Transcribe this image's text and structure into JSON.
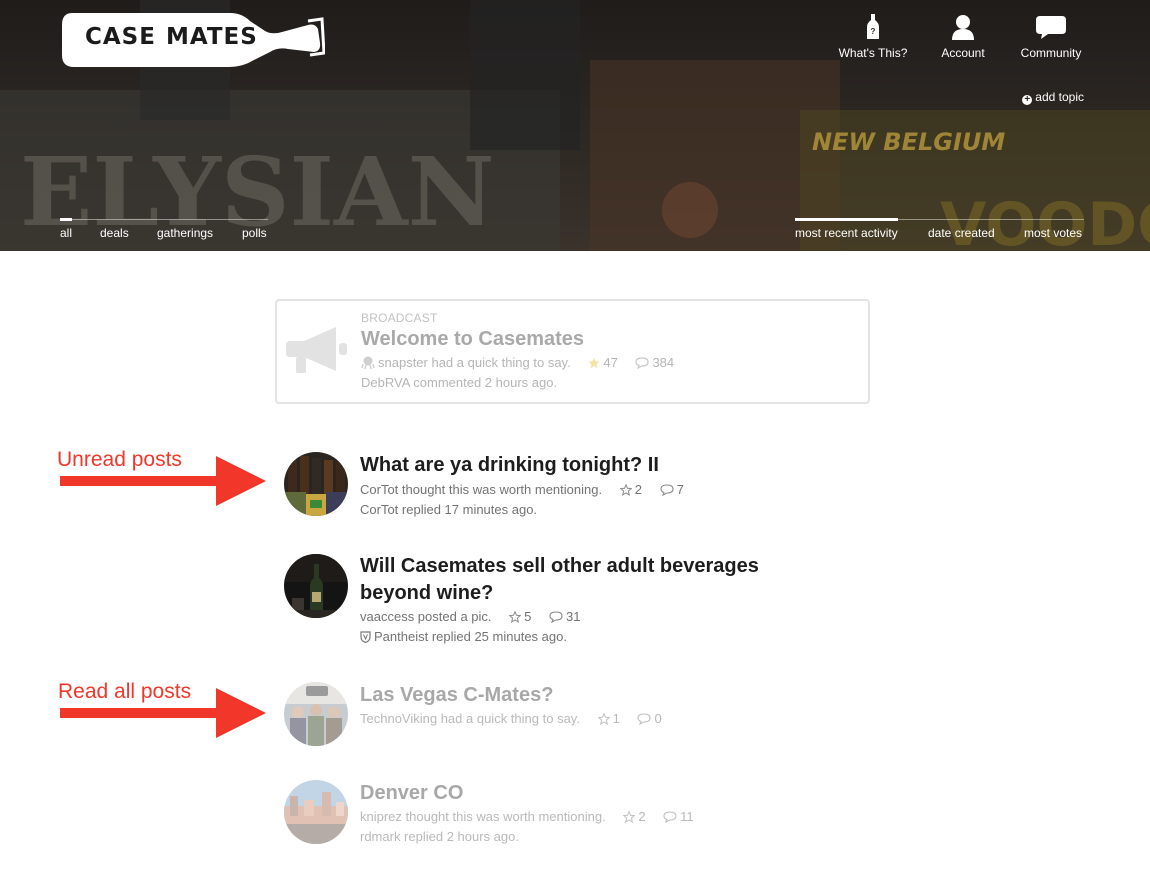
{
  "header": {
    "logo_left": "CASE",
    "logo_right": "MATES",
    "nav": [
      {
        "label": "What's This?",
        "icon": "bottle-icon"
      },
      {
        "label": "Account",
        "icon": "user-icon"
      },
      {
        "label": "Community",
        "icon": "speech-bubble-icon"
      }
    ],
    "add_topic": "add topic",
    "filters_left": [
      "all",
      "deals",
      "gatherings",
      "polls"
    ],
    "filters_left_active": "all",
    "filters_right": [
      "most recent activity",
      "date created",
      "most votes"
    ],
    "filters_right_active": "most recent activity"
  },
  "broadcast": {
    "label": "BROADCAST",
    "title": "Welcome to Casemates",
    "meta": "snapster had a quick thing to say.",
    "stars": "47",
    "comments": "384",
    "sub": "DebRVA commented 2 hours ago."
  },
  "posts": [
    {
      "title": "What are ya drinking tonight? II",
      "meta": "CorTot thought this was worth mentioning.",
      "stars": "2",
      "comments": "7",
      "sub": "CorTot replied 17 minutes ago.",
      "state": "unread"
    },
    {
      "title": "Will Casemates sell other adult beverages beyond wine?",
      "meta": "vaaccess posted a pic.",
      "stars": "5",
      "comments": "31",
      "sub": "Pantheist replied 25 minutes ago.",
      "state": "unread"
    },
    {
      "title": "Las Vegas C-Mates?",
      "meta": "TechnoViking had a quick thing to say.",
      "stars": "1",
      "comments": "0",
      "sub": "",
      "state": "read"
    },
    {
      "title": "Denver CO",
      "meta": "kniprez thought this was worth mentioning.",
      "stars": "2",
      "comments": "11",
      "sub": "rdmark replied 2 hours ago.",
      "state": "read"
    }
  ],
  "annotations": {
    "unread": "Unread posts",
    "read": "Read all posts",
    "color": "#f0372a"
  },
  "colors": {
    "header_bg": "#2b2622",
    "text_dark": "#1d1d1d",
    "text_muted": "#737373",
    "text_faded": "#b5b5b5"
  }
}
